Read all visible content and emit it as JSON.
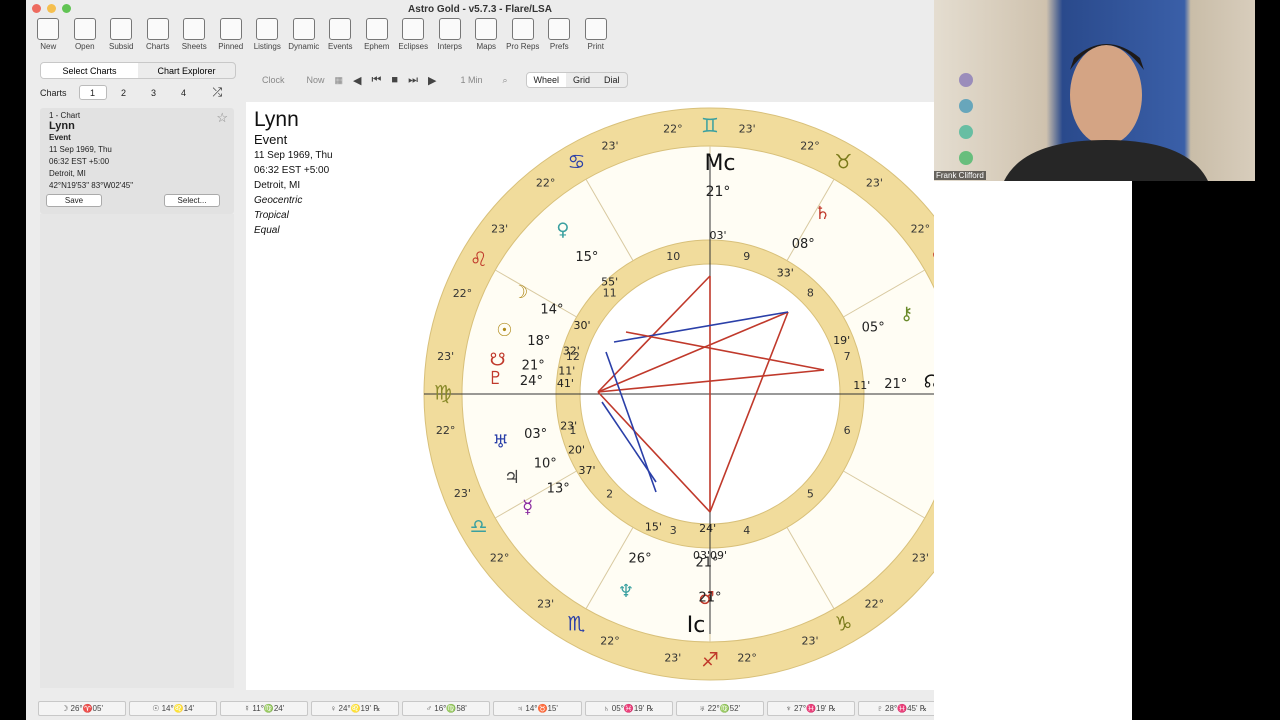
{
  "window": {
    "title": "Astro Gold - v5.7.3 - Flare/LSA"
  },
  "toolbar": [
    {
      "label": "New",
      "icon": "new-chart-icon"
    },
    {
      "label": "Open",
      "icon": "open-icon"
    },
    {
      "label": "Subsid",
      "icon": "subsid-icon"
    },
    {
      "label": "Charts",
      "icon": "charts-icon"
    },
    {
      "label": "Sheets",
      "icon": "sheets-icon"
    },
    {
      "label": "Pinned",
      "icon": "pinned-icon"
    },
    {
      "label": "Listings",
      "icon": "listings-icon"
    },
    {
      "label": "Dynamic",
      "icon": "dynamic-icon"
    },
    {
      "label": "Events",
      "icon": "events-icon"
    },
    {
      "label": "Ephem",
      "icon": "ephem-icon"
    },
    {
      "label": "Eclipses",
      "icon": "eclipses-icon"
    },
    {
      "label": "Interps",
      "icon": "interps-icon"
    },
    {
      "label": "Maps",
      "icon": "globe-icon"
    },
    {
      "label": "Pro Reps",
      "icon": "pro-reps-icon"
    },
    {
      "label": "Prefs",
      "icon": "gear-icon"
    },
    {
      "label": "Print",
      "icon": "printer-icon"
    }
  ],
  "sidebar": {
    "seg": [
      "Select Charts",
      "Chart Explorer"
    ],
    "charts_label": "Charts",
    "tabs": [
      "1",
      "2",
      "3",
      "4"
    ],
    "card": {
      "header": "1 - Chart",
      "name": "Lynn",
      "type": "Event",
      "date": "11 Sep 1969, Thu",
      "time": "06:32 EST +5:00",
      "place": "Detroit, MI",
      "coords": "42°N19'53\" 83°W02'45\"",
      "save": "Save",
      "select": "Select..."
    }
  },
  "navbar": {
    "clock": "Clock",
    "now": "Now",
    "step": "1 Min",
    "views": [
      "Wheel",
      "Grid",
      "Dial"
    ]
  },
  "chart_info": {
    "name": "Lynn",
    "type": "Event",
    "date": "11 Sep 1969, Thu",
    "time": "06:32 EST +5:00",
    "place": "Detroit, MI",
    "lines": [
      "Geocentric",
      "Tropical",
      "Equal"
    ]
  },
  "colors": {
    "ring": "#f1dc9c",
    "fire": "#c0392b",
    "air": "#8b8b2a",
    "water": "#2a3fa8",
    "earth": "#6a8a2a"
  },
  "chart_data": {
    "type": "astrology-wheel",
    "signs": [
      {
        "glyph": "♈",
        "color": "#c0392b"
      },
      {
        "glyph": "♉",
        "color": "#7a7a1a"
      },
      {
        "glyph": "♊",
        "color": "#3aa0a0"
      },
      {
        "glyph": "♋",
        "color": "#2a3fa8"
      },
      {
        "glyph": "♌",
        "color": "#c0392b"
      },
      {
        "glyph": "♍",
        "color": "#8a8a2a"
      },
      {
        "glyph": "♎",
        "color": "#3aa0a0"
      },
      {
        "glyph": "♏",
        "color": "#2a3fa8"
      },
      {
        "glyph": "♐",
        "color": "#c0392b"
      },
      {
        "glyph": "♑",
        "color": "#7a7a1a"
      },
      {
        "glyph": "♒",
        "color": "#3aa0a0"
      },
      {
        "glyph": "♓",
        "color": "#2a3fa8"
      }
    ],
    "cusp_labels": [
      {
        "deg": "22°",
        "min": "23'"
      },
      {
        "deg": "22°",
        "min": "23'"
      },
      {
        "deg": "22°",
        "min": "23'"
      },
      {
        "deg": "22°",
        "min": "23'"
      },
      {
        "deg": "22°",
        "min": "23'"
      },
      {
        "deg": "22°",
        "min": "23'"
      },
      {
        "deg": "22°",
        "min": "23'"
      },
      {
        "deg": "22°",
        "min": "23'"
      },
      {
        "deg": "22°",
        "min": "23'"
      },
      {
        "deg": "22°",
        "min": "23'"
      },
      {
        "deg": "22°",
        "min": "23'"
      },
      {
        "deg": "22°",
        "min": "23'"
      }
    ],
    "houses": [
      "1",
      "2",
      "3",
      "4",
      "5",
      "6",
      "7",
      "8",
      "9",
      "10",
      "11",
      "12"
    ],
    "planets": [
      {
        "name": "Moon",
        "glyph": "☽",
        "deg": "14°",
        "min": "30'",
        "color": "#b08a1a"
      },
      {
        "name": "Sun",
        "glyph": "☉",
        "deg": "18°",
        "min": "32'",
        "color": "#b08a1a"
      },
      {
        "name": "South Node",
        "glyph": "☋",
        "deg": "21°",
        "min": "11'",
        "color": "#c0392b"
      },
      {
        "name": "Pluto",
        "glyph": "♇",
        "deg": "24°",
        "min": "41'",
        "color": "#c0392b"
      },
      {
        "name": "Uranus",
        "glyph": "♅",
        "deg": "03°",
        "min": "23'",
        "color": "#2a3fa8"
      },
      {
        "name": "Jupiter",
        "glyph": "♃",
        "deg": "10°",
        "min": "20'",
        "color": "#444444"
      },
      {
        "name": "Mercury",
        "glyph": "☿",
        "deg": "13°",
        "min": "37'",
        "color": "#8a2aa0"
      },
      {
        "name": "Venus",
        "glyph": "♀",
        "deg": "15°",
        "min": "55'",
        "color": "#3aa0a0"
      },
      {
        "name": "Saturn",
        "glyph": "♄",
        "deg": "08°",
        "min": "33'",
        "color": "#c0392b"
      },
      {
        "name": "Chiron",
        "glyph": "⚷",
        "deg": "05°",
        "min": "19'",
        "color": "#6a8a2a"
      },
      {
        "name": "North Node",
        "glyph": "☊",
        "deg": "21°",
        "min": "11'",
        "color": "#111111"
      },
      {
        "name": "Neptune",
        "glyph": "♆",
        "deg": "26°",
        "min": "15'",
        "color": "#3aa0a0"
      },
      {
        "name": "Mars",
        "glyph": "♂",
        "deg": "21°",
        "min": "24'",
        "color": "#c0392b"
      }
    ],
    "mc": {
      "label": "Mc",
      "deg": "21°",
      "min": "03'"
    },
    "ic": {
      "label": "Ic",
      "deg": "21°",
      "min": "24°",
      "extra": "03'09'"
    }
  },
  "status": [
    "☽ 26°♈05'",
    "☉ 14°♌14'",
    "☿ 11°♍24'",
    "♀ 24°♌19' ℞",
    "♂ 16°♍58'",
    "♃ 14°♉15'",
    "♄ 05°♓19' ℞",
    "♅ 22°♍52'",
    "♆ 27°♓19' ℞",
    "♇ 28°♓45' ℞"
  ],
  "video": {
    "name": "Frank Clifford"
  }
}
